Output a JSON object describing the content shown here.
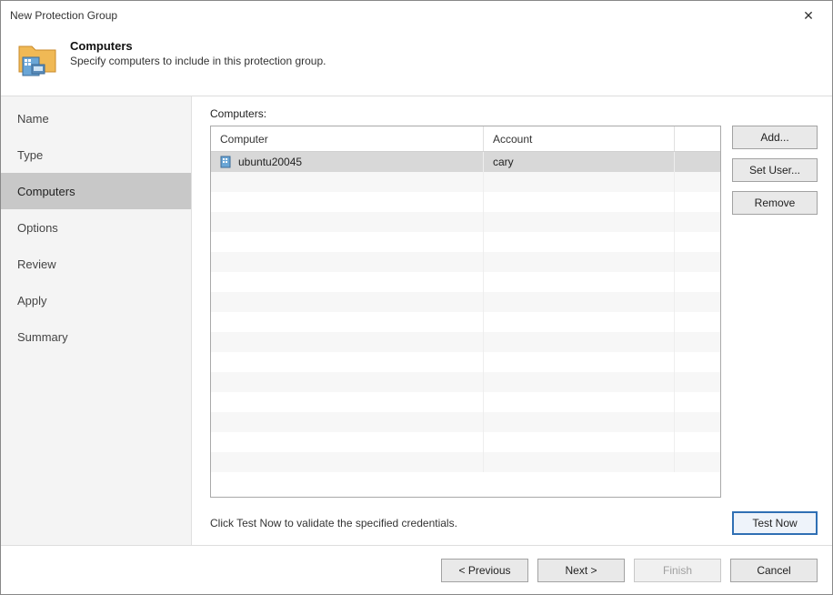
{
  "window": {
    "title": "New Protection Group",
    "close_label": "✕"
  },
  "header": {
    "title": "Computers",
    "subtitle": "Specify computers to include in this protection group."
  },
  "sidebar": {
    "items": [
      {
        "label": "Name",
        "active": false
      },
      {
        "label": "Type",
        "active": false
      },
      {
        "label": "Computers",
        "active": true
      },
      {
        "label": "Options",
        "active": false
      },
      {
        "label": "Review",
        "active": false
      },
      {
        "label": "Apply",
        "active": false
      },
      {
        "label": "Summary",
        "active": false
      }
    ]
  },
  "main": {
    "label": "Computers:",
    "columns": {
      "computer": "Computer",
      "account": "Account"
    },
    "rows": [
      {
        "computer": "ubuntu20045",
        "account": "cary",
        "selected": true
      }
    ],
    "side_buttons": {
      "add": "Add...",
      "set_user": "Set User...",
      "remove": "Remove"
    },
    "hint": "Click Test Now to validate the specified credentials.",
    "test_now": "Test Now"
  },
  "footer": {
    "previous": "<  Previous",
    "next": "Next  >",
    "finish": "Finish",
    "cancel": "Cancel"
  }
}
